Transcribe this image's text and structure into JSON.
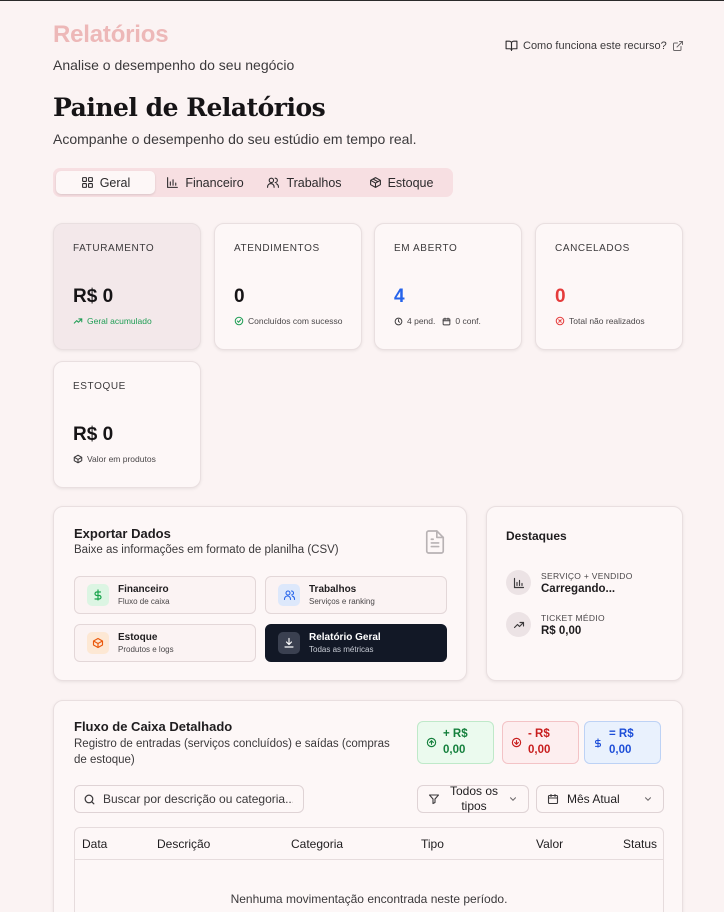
{
  "header": {
    "title": "Relatórios",
    "subtitle": "Analise o desempenho do seu negócio",
    "help_link": "Como funciona este recurso?"
  },
  "panel": {
    "title": "Painel de Relatórios",
    "subtitle": "Acompanhe o desempenho do seu estúdio em tempo real."
  },
  "tabs": [
    {
      "label": "Geral",
      "icon": "grid-icon",
      "active": true
    },
    {
      "label": "Financeiro",
      "icon": "bar-chart-icon",
      "active": false
    },
    {
      "label": "Trabalhos",
      "icon": "users-icon",
      "active": false
    },
    {
      "label": "Estoque",
      "icon": "package-icon",
      "active": false
    }
  ],
  "stats": {
    "revenue": {
      "label": "FATURAMENTO",
      "value": "R$ 0",
      "note": "Geral acumulado"
    },
    "appointments": {
      "label": "ATENDIMENTOS",
      "value": "0",
      "note": "Concluídos com sucesso"
    },
    "open": {
      "label": "EM ABERTO",
      "value": "4",
      "note_pending": "4 pend.",
      "note_confirmed": "0 conf."
    },
    "cancelled": {
      "label": "CANCELADOS",
      "value": "0",
      "note": "Total não realizados"
    },
    "stock": {
      "label": "ESTOQUE",
      "value": "R$ 0",
      "note": "Valor em produtos"
    }
  },
  "export": {
    "title": "Exportar Dados",
    "subtitle": "Baixe as informações em formato de planilha (CSV)",
    "buttons": {
      "financial": {
        "title": "Financeiro",
        "sub": "Fluxo de caixa"
      },
      "jobs": {
        "title": "Trabalhos",
        "sub": "Serviços e ranking"
      },
      "stock": {
        "title": "Estoque",
        "sub": "Produtos e logs"
      },
      "general": {
        "title": "Relatório Geral",
        "sub": "Todas as métricas"
      }
    }
  },
  "highlights": {
    "title": "Destaques",
    "top_service": {
      "label": "SERVIÇO + VENDIDO",
      "value": "Carregando..."
    },
    "avg_ticket": {
      "label": "TICKET MÉDIO",
      "value": "R$ 0,00"
    }
  },
  "cashflow": {
    "title": "Fluxo de Caixa Detalhado",
    "subtitle": "Registro de entradas (serviços concluídos) e saídas (compras de estoque)",
    "income": {
      "line1": "+ R$",
      "line2": "0,00"
    },
    "expense": {
      "line1": "- R$",
      "line2": "0,00"
    },
    "balance": {
      "line1": "= R$",
      "line2": "0,00"
    },
    "search_placeholder": "Buscar por descrição ou categoria...",
    "type_filter": {
      "line1": "Todos os",
      "line2": "tipos"
    },
    "period_filter": "Mês Atual",
    "columns": [
      "Data",
      "Descrição",
      "Categoria",
      "Tipo",
      "Valor",
      "Status"
    ],
    "empty_message": "Nenhuma movimentação encontrada neste período."
  },
  "colors": {
    "accent_pink": "#edb8b8",
    "blue": "#2563eb",
    "red": "#e53b3b",
    "green": "#1f9d55",
    "dark": "#121826"
  }
}
